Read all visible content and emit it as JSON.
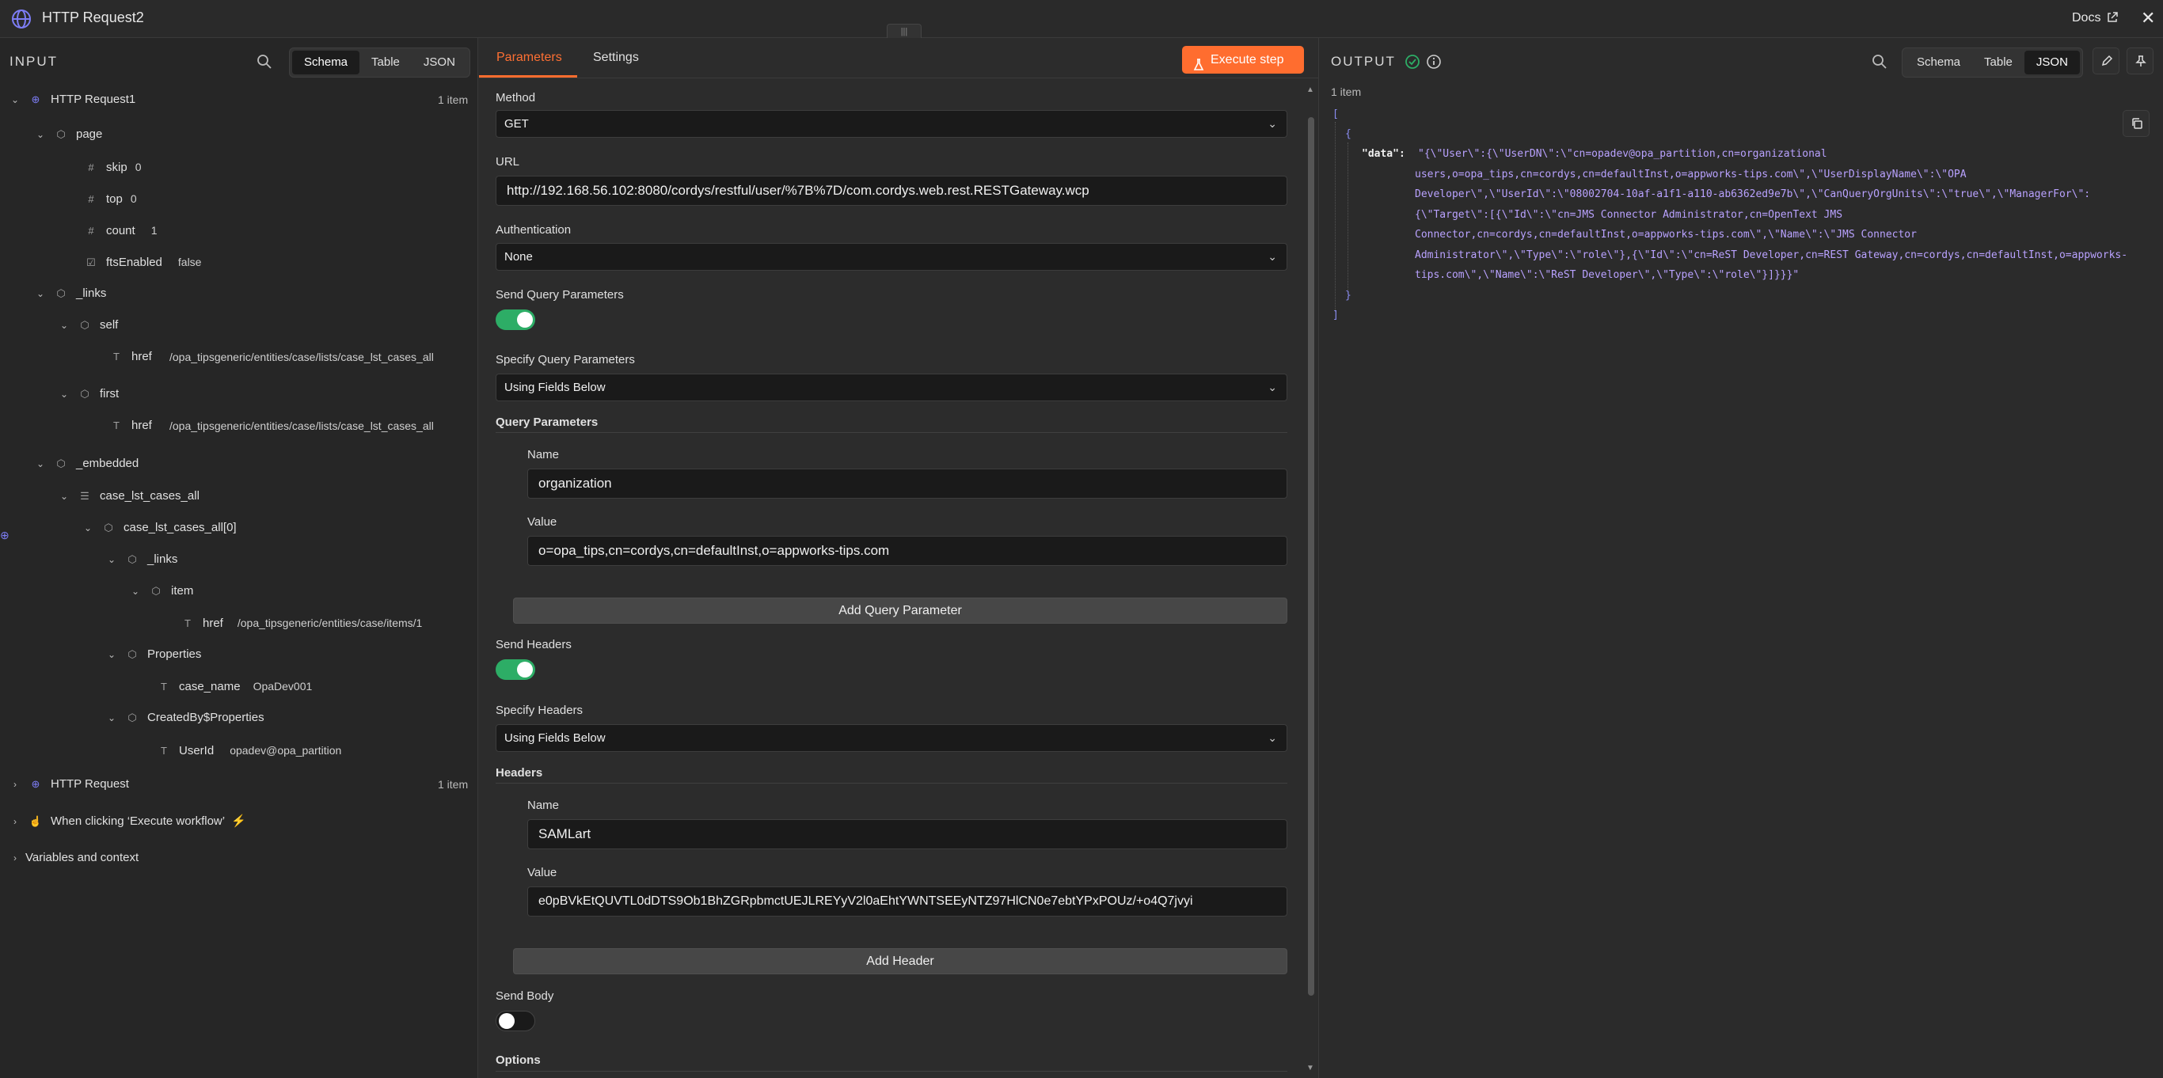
{
  "header": {
    "title": "HTTP Request2",
    "docs_label": "Docs",
    "handle_glyph": "|||"
  },
  "input_panel": {
    "label": "INPUT",
    "view_tabs": [
      "Schema",
      "Table",
      "JSON"
    ],
    "active_view": "Schema",
    "tree": {
      "node1": {
        "label": "HTTP Request1",
        "count": "1 item"
      },
      "page": "page",
      "skip": {
        "key": "skip",
        "value": "0"
      },
      "top": {
        "key": "top",
        "value": "0"
      },
      "count": {
        "key": "count",
        "value": "1"
      },
      "ftsEnabled": {
        "key": "ftsEnabled",
        "value": "false"
      },
      "links": "_links",
      "self": "self",
      "self_href": {
        "key": "href",
        "value": "/opa_tipsgeneric/entities/case/lists/case_lst_cases_all"
      },
      "first": "first",
      "first_href": {
        "key": "href",
        "value": "/opa_tipsgeneric/entities/case/lists/case_lst_cases_all"
      },
      "embedded": "_embedded",
      "case_list": "case_lst_cases_all",
      "case_item0": "case_lst_cases_all[0]",
      "item_links": "_links",
      "item": "item",
      "item_href": {
        "key": "href",
        "value": "/opa_tipsgeneric/entities/case/items/1"
      },
      "properties": "Properties",
      "case_name": {
        "key": "case_name",
        "value": "OpaDev001"
      },
      "createdby": "CreatedBy$Properties",
      "userid": {
        "key": "UserId",
        "value": "opadev@opa_partition"
      },
      "node2": {
        "label": "HTTP Request",
        "count": "1 item"
      },
      "node3": {
        "label": "When clicking ‘Execute workflow’"
      },
      "vars": "Variables and context"
    }
  },
  "params_panel": {
    "tabs": [
      "Parameters",
      "Settings"
    ],
    "active_tab": "Parameters",
    "execute_label": "Execute step",
    "method": {
      "label": "Method",
      "value": "GET"
    },
    "url": {
      "label": "URL",
      "value": "http://192.168.56.102:8080/cordys/restful/user/%7B%7D/com.cordys.web.rest.RESTGateway.wcp"
    },
    "authentication": {
      "label": "Authentication",
      "value": "None"
    },
    "send_query": {
      "label": "Send Query Parameters",
      "on": true
    },
    "specify_query": {
      "label": "Specify Query Parameters",
      "value": "Using Fields Below"
    },
    "query_params": {
      "section_label": "Query Parameters",
      "name_label": "Name",
      "name_value": "organization",
      "value_label": "Value",
      "value_value": "o=opa_tips,cn=cordys,cn=defaultInst,o=appworks-tips.com",
      "add_label": "Add Query Parameter"
    },
    "send_headers": {
      "label": "Send Headers",
      "on": true
    },
    "specify_headers": {
      "label": "Specify Headers",
      "value": "Using Fields Below"
    },
    "headers": {
      "section_label": "Headers",
      "name_label": "Name",
      "name_value": "SAMLart",
      "value_label": "Value",
      "value_value": "e0pBVkEtQUVTL0dDTS9Ob1BhZGRpbmctUEJLREYyV2l0aEhtYWNTSEEyNTZ97HlCN0e7ebtYPxPOUz/+o4Q7jvyi",
      "add_label": "Add Header"
    },
    "send_body": {
      "label": "Send Body",
      "on": false
    },
    "options_label": "Options"
  },
  "output_panel": {
    "label": "OUTPUT",
    "count": "1 item",
    "view_tabs": [
      "Schema",
      "Table",
      "JSON"
    ],
    "active_view": "JSON",
    "json": {
      "open_bracket": "[",
      "open_brace": "{",
      "key": "\"data\":",
      "lines": [
        "\"{\\\"User\\\":{\\\"UserDN\\\":\\\"cn=opadev@opa_partition,cn=organizational",
        "users,o=opa_tips,cn=cordys,cn=defaultInst,o=appworks-tips.com\\\",\\\"UserDisplayName\\\":\\\"OPA",
        "Developer\\\",\\\"UserId\\\":\\\"08002704-10af-a1f1-a110-ab6362ed9e7b\\\",\\\"CanQueryOrgUnits\\\":\\\"true\\\",\\\"ManagerFor\\\":",
        "{\\\"Target\\\":[{\\\"Id\\\":\\\"cn=JMS Connector Administrator,cn=OpenText JMS",
        "Connector,cn=cordys,cn=defaultInst,o=appworks-tips.com\\\",\\\"Name\\\":\\\"JMS Connector",
        "Administrator\\\",\\\"Type\\\":\\\"role\\\"},{\\\"Id\\\":\\\"cn=ReST Developer,cn=REST Gateway,cn=cordys,cn=defaultInst,o=appworks-",
        "tips.com\\\",\\\"Name\\\":\\\"ReST Developer\\\",\\\"Type\\\":\\\"role\\\"}]}}}\""
      ],
      "close_brace": "}",
      "close_bracket": "]"
    }
  },
  "colors": {
    "accent": "#ff6d2f",
    "toggle_on": "#2dad66",
    "json_string": "#b9a2ff"
  }
}
